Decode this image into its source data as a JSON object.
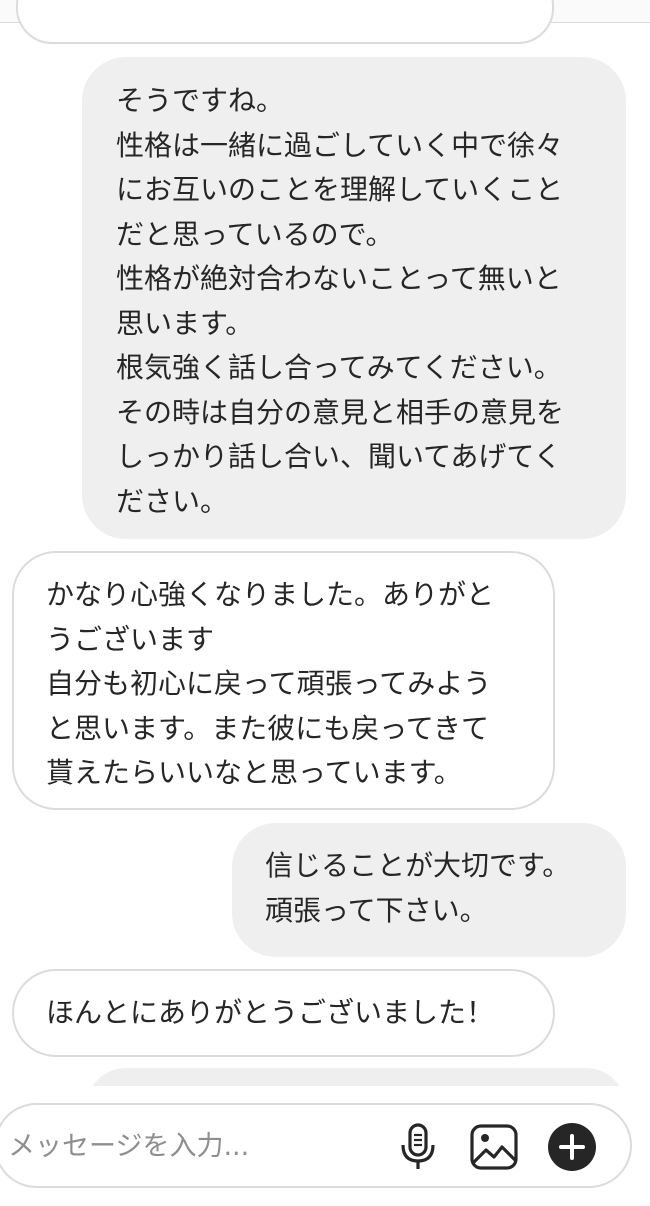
{
  "thread": {
    "messages": [
      {
        "direction": "outgoing",
        "lines": [
          "そうですね。",
          "性格は一緒に過ごしていく中で徐々",
          "にお互いのことを理解していくこと",
          "だと思っているので。",
          "性格が絶対合わないことって無いと",
          "思います。",
          "根気強く話し合ってみてください。",
          "その時は自分の意見と相手の意見を",
          "しっかり話し合い、聞いてあげてく",
          "ださい。"
        ]
      },
      {
        "direction": "incoming",
        "lines": [
          "かなり心強くなりました。ありがと",
          "うございます",
          "自分も初心に戻って頑張ってみよう",
          "と思います。また彼にも戻ってきて",
          "貰えたらいいなと思っています。"
        ]
      },
      {
        "direction": "outgoing",
        "lines": [
          "信じることが大切です。",
          "頑張って下さい。"
        ]
      },
      {
        "direction": "incoming",
        "lines": [
          "ほんとにありがとうございました！"
        ]
      }
    ]
  },
  "composer": {
    "placeholder": "メッセージを入力...",
    "value": "",
    "icons": [
      "microphone-icon",
      "image-icon",
      "add-icon"
    ]
  },
  "colors": {
    "outgoing_bubble": "#efefef",
    "incoming_bubble": "#ffffff",
    "bubble_border": "#dbdbdb",
    "text": "#262626",
    "placeholder": "#8e8e8e",
    "online_indicator": "#4cd964"
  }
}
